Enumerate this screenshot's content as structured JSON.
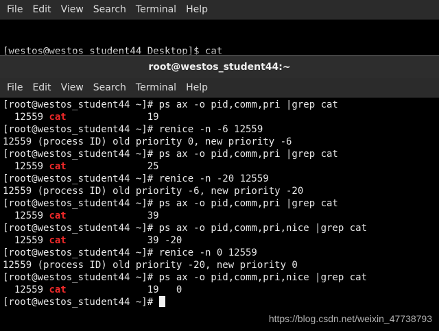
{
  "back_window": {
    "menu": [
      "File",
      "Edit",
      "View",
      "Search",
      "Terminal",
      "Help"
    ],
    "prompt": "[westos@westos_student44 Desktop]$ cat"
  },
  "front_window": {
    "title": "root@westos_student44:~",
    "menu": [
      "File",
      "Edit",
      "View",
      "Search",
      "Terminal",
      "Help"
    ],
    "lines": [
      {
        "pre": "[root@westos_student44 ~]# ps ax -o pid,comm,pri |grep cat"
      },
      {
        "pre": "  12559 ",
        "hl": "cat",
        "post": "              19"
      },
      {
        "pre": "[root@westos_student44 ~]# renice -n -6 12559"
      },
      {
        "pre": "12559 (process ID) old priority 0, new priority -6"
      },
      {
        "pre": "[root@westos_student44 ~]# ps ax -o pid,comm,pri |grep cat"
      },
      {
        "pre": "  12559 ",
        "hl": "cat",
        "post": "              25"
      },
      {
        "pre": "[root@westos_student44 ~]# renice -n -20 12559"
      },
      {
        "pre": "12559 (process ID) old priority -6, new priority -20"
      },
      {
        "pre": "[root@westos_student44 ~]# ps ax -o pid,comm,pri |grep cat"
      },
      {
        "pre": "  12559 ",
        "hl": "cat",
        "post": "              39"
      },
      {
        "pre": "[root@westos_student44 ~]# ps ax -o pid,comm,pri,nice |grep cat"
      },
      {
        "pre": "  12559 ",
        "hl": "cat",
        "post": "              39 -20"
      },
      {
        "pre": "[root@westos_student44 ~]# renice -n 0 12559"
      },
      {
        "pre": "12559 (process ID) old priority -20, new priority 0"
      },
      {
        "pre": "[root@westos_student44 ~]# ps ax -o pid,comm,pri,nice |grep cat"
      },
      {
        "pre": "  12559 ",
        "hl": "cat",
        "post": "              19   0"
      },
      {
        "pre": "[root@westos_student44 ~]# ",
        "cursor": true
      }
    ]
  },
  "watermark": "https://blog.csdn.net/weixin_47738793",
  "colors": {
    "highlight": "#ef2929",
    "background": "#000000",
    "menubar": "#2b2b2b"
  }
}
